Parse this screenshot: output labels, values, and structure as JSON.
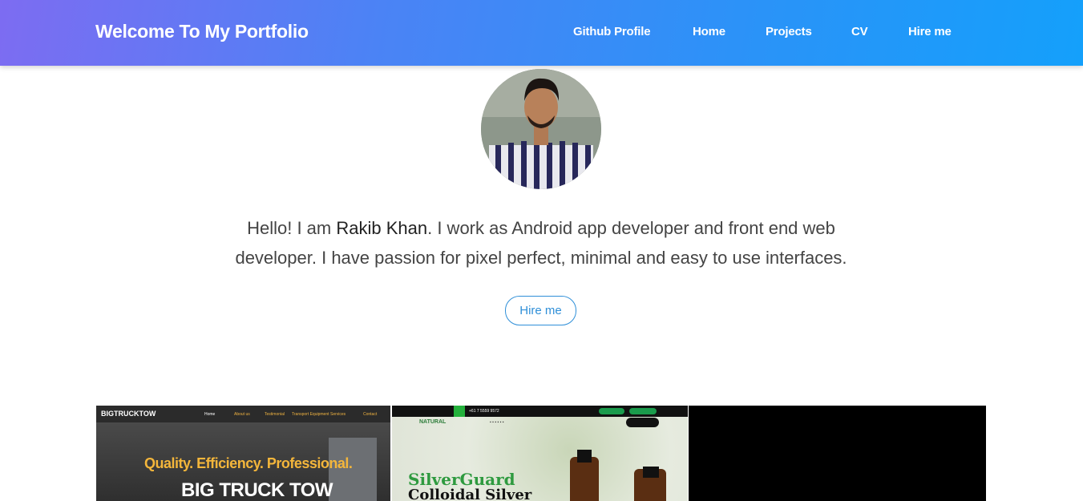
{
  "header": {
    "brand": "Welcome To My Portfolio",
    "nav": [
      {
        "label": "Github Profile"
      },
      {
        "label": "Home"
      },
      {
        "label": "Projects"
      },
      {
        "label": "CV"
      },
      {
        "label": "Hire me"
      }
    ]
  },
  "intro": {
    "text_before": "Hello! I am ",
    "name": "Rakib Khan",
    "text_after": ". I work as Android app developer and front end web developer. I have passion for pixel perfect, minimal and easy to use interfaces.",
    "hire_button": "Hire me"
  },
  "projects": [
    {
      "logo": "BIGTRUCKTOW",
      "menu": [
        "Home",
        "About us",
        "Testimonial",
        "Transport Equipment",
        "Services",
        "Contact"
      ],
      "tagline": "Quality. Efficiency. Professional.",
      "title": "BIG TRUCK TOW"
    },
    {
      "brand": "NATURAL",
      "phone": "+61 7 5559 9572",
      "heading1": "SilverGuard",
      "heading2": "Colloidal Silver"
    },
    {}
  ],
  "colors": {
    "header_gradient_start": "#7d6cf2",
    "header_gradient_end": "#14a0fb",
    "accent": "#2f8fd8"
  }
}
